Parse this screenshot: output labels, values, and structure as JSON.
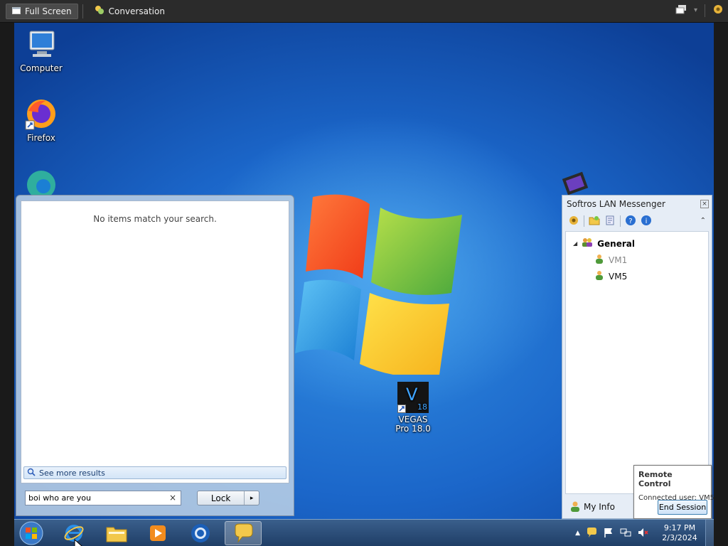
{
  "viewer_bar": {
    "fullscreen_label": "Full Screen",
    "conversation_label": "Conversation"
  },
  "desktop": {
    "icons": [
      {
        "label": "Computer",
        "icon": "computer-icon"
      },
      {
        "label": "Firefox",
        "icon": "firefox-icon"
      },
      {
        "label": "VEGAS Pro 18.0",
        "icon": "vegas-pro-icon",
        "badge": "V",
        "badge_num": "18"
      }
    ]
  },
  "search_pane": {
    "no_items_text": "No items match your search.",
    "see_more_label": "See more results",
    "search_value": "boi who are you",
    "clear_symbol": "×",
    "lock_label": "Lock",
    "lock_arrow": "▸"
  },
  "messenger": {
    "title": "Softros LAN Messenger",
    "group_name": "General",
    "contacts": [
      {
        "name": "VM1",
        "status": "offline"
      },
      {
        "name": "VM5",
        "status": "online"
      }
    ],
    "my_info_label": "My Info",
    "collapse_symbol": "⌃",
    "close_symbol": "×"
  },
  "remote_control": {
    "title": "Remote Control",
    "connected_user": "Connected user: VM5",
    "end_session_label": "End Session"
  },
  "taskbar": {
    "items": [
      "internet-explorer-icon",
      "file-explorer-icon",
      "media-player-icon",
      "chrome-icon",
      "messenger-icon"
    ],
    "time": "9:17 PM",
    "date": "2/3/2024"
  },
  "colors": {
    "desktop_blue": "#1b66c9",
    "taskbar": "#1f3e66",
    "offline_contact": "#888888"
  }
}
